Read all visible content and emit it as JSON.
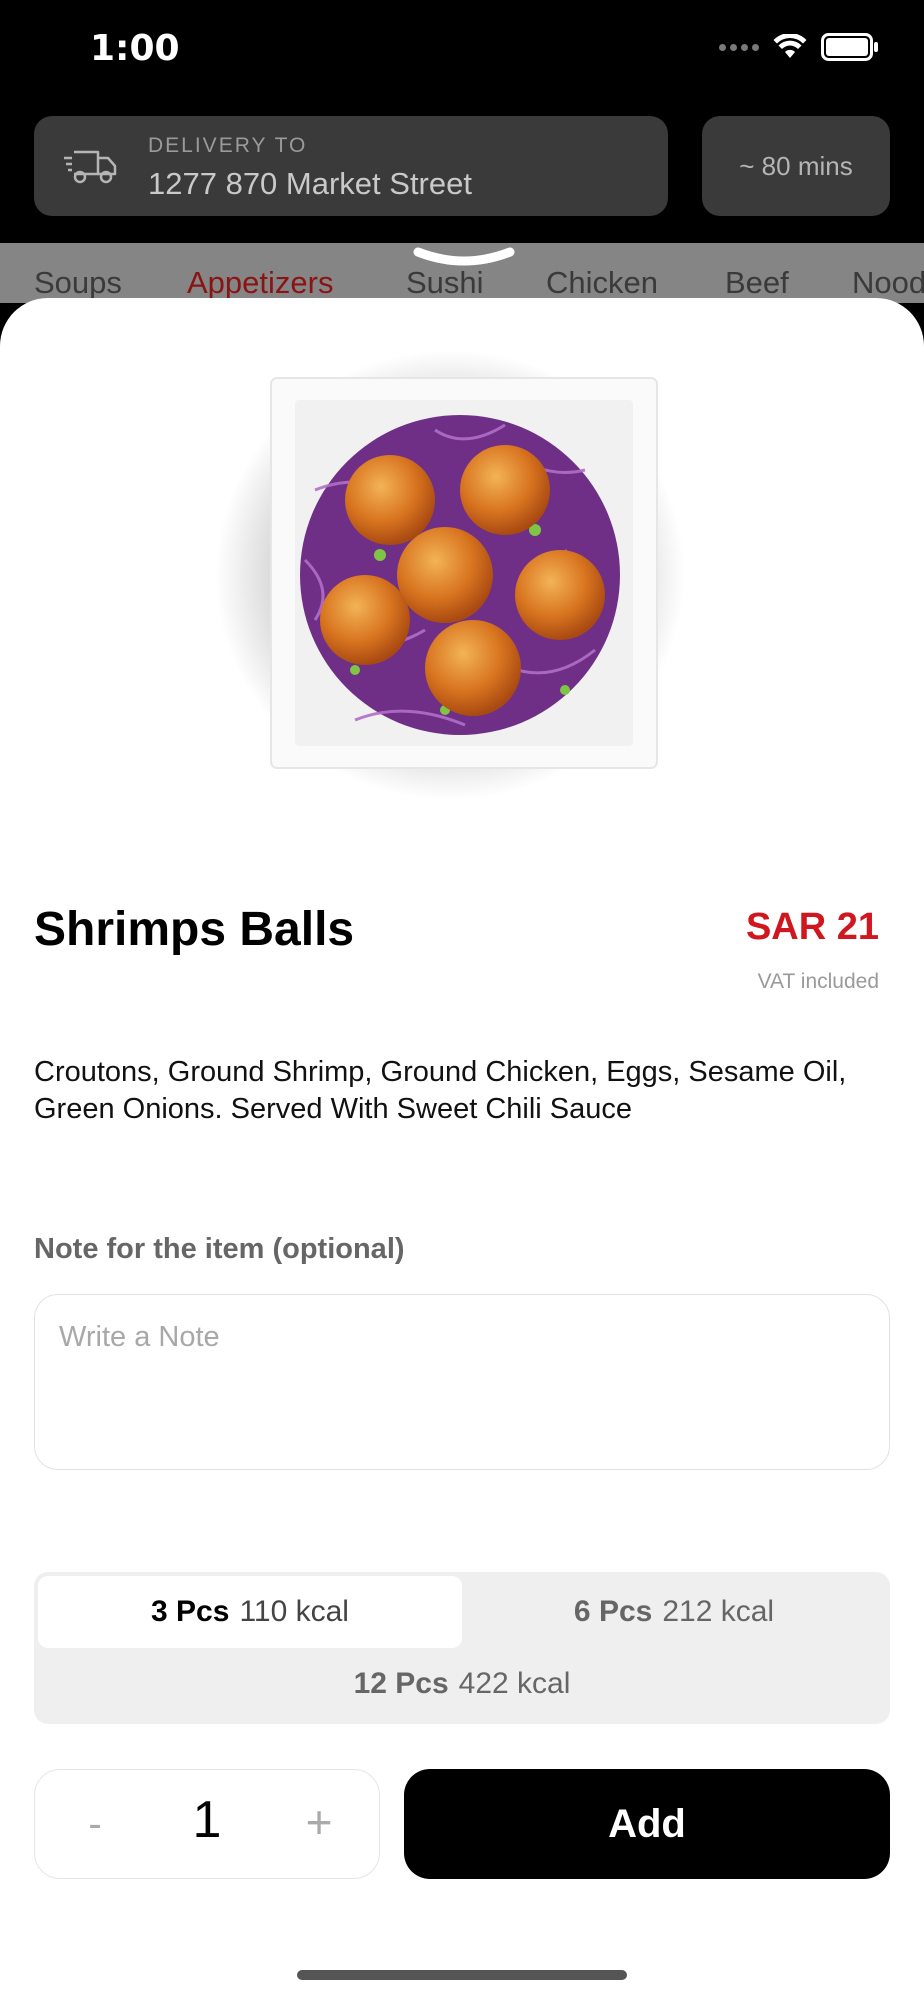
{
  "status_bar": {
    "time": "1:00"
  },
  "header": {
    "delivery_label": "DELIVERY TO",
    "delivery_address": "1277 870 Market Street",
    "eta": "~ 80 mins"
  },
  "categories": [
    {
      "label": "Soups",
      "active": false
    },
    {
      "label": "Appetizers",
      "active": true
    },
    {
      "label": "Sushi",
      "active": false
    },
    {
      "label": "Chicken",
      "active": false
    },
    {
      "label": "Beef",
      "active": false
    },
    {
      "label": "Noodles",
      "active": false
    }
  ],
  "item": {
    "name": "Shrimps Balls",
    "price": "SAR 21",
    "vat_note": "VAT included",
    "description": "Croutons, Ground Shrimp, Ground Chicken, Eggs, Sesame Oil, Green Onions. Served With Sweet Chili Sauce",
    "image_icon": "dish-photo"
  },
  "note": {
    "label": "Note for the item (optional)",
    "placeholder": "Write a Note",
    "value": ""
  },
  "sizes": [
    {
      "pcs": "3 Pcs",
      "kcal": "110 kcal",
      "selected": true
    },
    {
      "pcs": "6 Pcs",
      "kcal": "212 kcal",
      "selected": false
    },
    {
      "pcs": "12 Pcs",
      "kcal": "422 kcal",
      "selected": false
    }
  ],
  "quantity": {
    "minus": "-",
    "value": "1",
    "plus": "+"
  },
  "actions": {
    "add_label": "Add"
  },
  "colors": {
    "accent": "#d0161f",
    "active_category": "#8a1414",
    "primary_button": "#000000"
  }
}
